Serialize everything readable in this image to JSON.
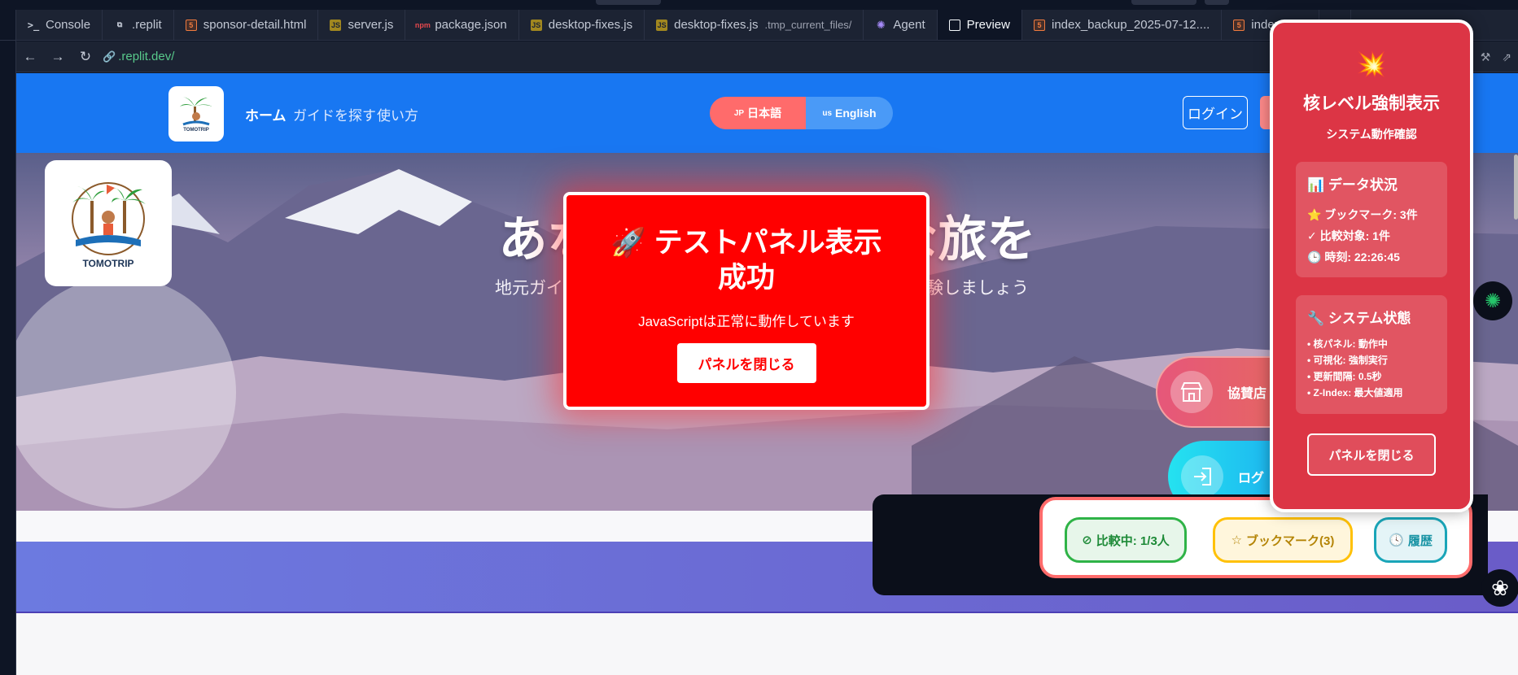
{
  "editor": {
    "tabs": [
      {
        "label": "Console",
        "icon": "terminal-icon"
      },
      {
        "label": ".replit",
        "icon": "replit-icon"
      },
      {
        "label": "sponsor-detail.html",
        "icon": "html-icon"
      },
      {
        "label": "server.js",
        "icon": "js-icon"
      },
      {
        "label": "package.json",
        "icon": "json-icon"
      },
      {
        "label": "desktop-fixes.js",
        "icon": "js-icon"
      },
      {
        "label": "desktop-fixes.js",
        "suffix": ".tmp_current_files/",
        "icon": "js-icon"
      },
      {
        "label": "Agent",
        "icon": "agent-icon"
      },
      {
        "label": "Preview",
        "icon": "preview-icon",
        "active": true
      },
      {
        "label": "index_backup_2025-07-12....",
        "icon": "html-icon"
      },
      {
        "label": "index.html",
        "icon": "html-icon"
      }
    ],
    "new_tab": "+",
    "url": ".replit.dev/"
  },
  "site": {
    "nav": {
      "home": "ホーム",
      "find_guide": "ガイドを探す",
      "how_to": "使い方"
    },
    "lang": {
      "ja_flag": "JP",
      "ja": "日本語",
      "en_flag": "us",
      "en": "English"
    },
    "login": "ログイン",
    "logo_text": "TOMOTRIP",
    "hero": {
      "title": "あなただけの特別な旅を",
      "sub_left": "地元ガイド",
      "sub_right": "験しましょう"
    },
    "side_pills": {
      "sponsor": "協賛店",
      "login": "ログ"
    }
  },
  "test_panel": {
    "title_line1": "🚀 テストパネル表示",
    "title_line2": "成功",
    "message": "JavaScriptは正常に動作しています",
    "close": "パネルを閉じる"
  },
  "core_panel": {
    "icon": "💥",
    "title": "核レベル強制表示",
    "subtitle": "システム動作確認",
    "data_title": "📊 データ状況",
    "bookmarks": "⭐ ブックマーク: 3件",
    "compare": "✓ 比較対象: 1件",
    "time": "🕒 時刻: 22:26:45",
    "system_title": "🔧 システム状態",
    "status_core": "• 核パネル: 動作中",
    "status_visual": "• 可視化: 強制実行",
    "status_interval": "• 更新間隔: 0.5秒",
    "status_z": "• Z-Index: 最大値適用",
    "close": "パネルを閉じる"
  },
  "action_bar": {
    "compare": "比較中: 1/3人",
    "bookmark": "ブックマーク(3)",
    "history": "履歴"
  },
  "colors": {
    "header_blue": "#1877f2",
    "test_red": "#ff0000",
    "core_red": "#dc3545",
    "compare_green": "#2fb347",
    "bookmark_amber": "#ffc107",
    "history_teal": "#1aa5b8"
  }
}
